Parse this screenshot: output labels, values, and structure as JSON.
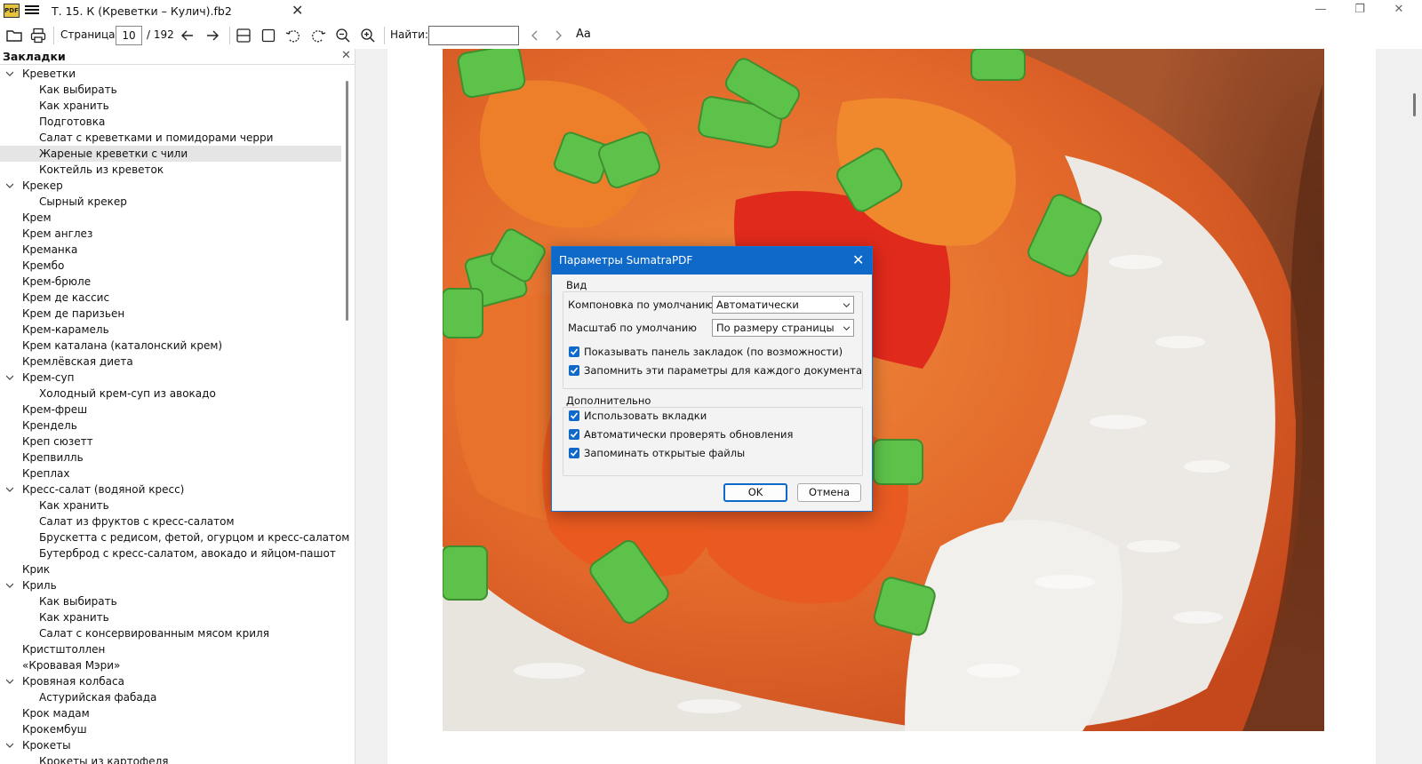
{
  "window": {
    "tab_title": "Т. 15. К (Креветки – Кулич).fb2",
    "app_icon_text": "PDF"
  },
  "toolbar": {
    "page_label": "Страница:",
    "page_value": "10",
    "page_total": "/ 192",
    "find_label": "Найти:",
    "find_value": "",
    "font_button": "Aa"
  },
  "sidebar": {
    "title": "Закладки",
    "items": [
      {
        "label": "Креветки",
        "level": 0,
        "expanded": true
      },
      {
        "label": "Как выбирать",
        "level": 1
      },
      {
        "label": "Как хранить",
        "level": 1
      },
      {
        "label": "Подготовка",
        "level": 1
      },
      {
        "label": "Салат с креветками и помидорами черри",
        "level": 1
      },
      {
        "label": "Жареные креветки с чили",
        "level": 1,
        "selected": true
      },
      {
        "label": "Коктейль из креветок",
        "level": 1
      },
      {
        "label": "Крекер",
        "level": 0,
        "expanded": true
      },
      {
        "label": "Сырный крекер",
        "level": 1
      },
      {
        "label": "Крем",
        "level": 0
      },
      {
        "label": "Крем англез",
        "level": 0
      },
      {
        "label": "Креманка",
        "level": 0
      },
      {
        "label": "Крембо",
        "level": 0
      },
      {
        "label": "Крем-брюле",
        "level": 0
      },
      {
        "label": "Крем де кассис",
        "level": 0
      },
      {
        "label": "Крем де паризьен",
        "level": 0
      },
      {
        "label": "Крем-карамель",
        "level": 0
      },
      {
        "label": "Крем каталана (каталонский крем)",
        "level": 0
      },
      {
        "label": "Кремлёвская диета",
        "level": 0
      },
      {
        "label": "Крем-суп",
        "level": 0,
        "expanded": true
      },
      {
        "label": "Холодный крем-суп из авокадо",
        "level": 1
      },
      {
        "label": "Крем-фреш",
        "level": 0
      },
      {
        "label": "Крендель",
        "level": 0
      },
      {
        "label": "Креп сюзетт",
        "level": 0
      },
      {
        "label": "Крепвилль",
        "level": 0
      },
      {
        "label": "Креплах",
        "level": 0
      },
      {
        "label": "Кресс-салат (водяной кресс)",
        "level": 0,
        "expanded": true
      },
      {
        "label": "Как хранить",
        "level": 1
      },
      {
        "label": "Салат из фруктов с кресс-салатом",
        "level": 1
      },
      {
        "label": "Брускетта с редисом, фетой, огурцом и кресс-салатом",
        "level": 1
      },
      {
        "label": "Бутерброд с кресс-салатом, авокадо и яйцом-пашот",
        "level": 1
      },
      {
        "label": "Крик",
        "level": 0
      },
      {
        "label": "Криль",
        "level": 0,
        "expanded": true
      },
      {
        "label": "Как выбирать",
        "level": 1
      },
      {
        "label": "Как хранить",
        "level": 1
      },
      {
        "label": "Салат с консервированным мясом криля",
        "level": 1
      },
      {
        "label": "Кристштоллен",
        "level": 0
      },
      {
        "label": "«Кровавая Мэри»",
        "level": 0
      },
      {
        "label": "Кровяная колбаса",
        "level": 0,
        "expanded": true
      },
      {
        "label": "Астурийская фабада",
        "level": 1
      },
      {
        "label": "Крок мадам",
        "level": 0
      },
      {
        "label": "Крокембуш",
        "level": 0
      },
      {
        "label": "Крокеты",
        "level": 0,
        "expanded": true
      },
      {
        "label": "Крокеты из картофеля",
        "level": 1
      }
    ]
  },
  "dialog": {
    "title": "Параметры SumatraPDF",
    "view_group": "Вид",
    "layout_label": "Компоновка по умолчанию",
    "layout_value": "Автоматически",
    "zoom_label": "Масштаб по умолчанию",
    "zoom_value": "По размеру страницы",
    "show_bookmarks": {
      "label": "Показывать панель закладок (по возможности)",
      "checked": true
    },
    "remember_settings": {
      "label": "Запомнить эти параметры для каждого документа",
      "checked": true
    },
    "advanced_group": "Дополнительно",
    "use_tabs": {
      "label": "Использовать вкладки",
      "checked": true
    },
    "check_updates": {
      "label": "Автоматически проверять обновления",
      "checked": true
    },
    "remember_files": {
      "label": "Запоминать открытые файлы",
      "checked": true
    },
    "ok_label": "OK",
    "cancel_label": "Отмена"
  },
  "colors": {
    "accent": "#0f69c9",
    "selection": "#e5e5e5"
  }
}
